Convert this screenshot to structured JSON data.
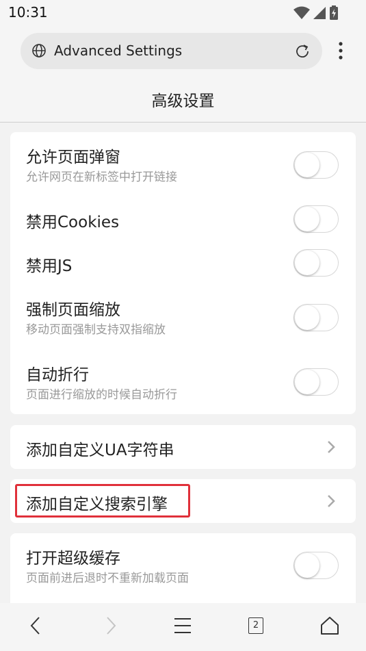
{
  "status": {
    "time": "10:31"
  },
  "urlbar": {
    "text": "Advanced Settings"
  },
  "page": {
    "title": "高级设置"
  },
  "group1": [
    {
      "title": "允许页面弹窗",
      "subtitle": "允许网页在新标签中打开链接",
      "enabled": false
    },
    {
      "title": "禁用Cookies",
      "subtitle": "",
      "enabled": false
    },
    {
      "title": "禁用JS",
      "subtitle": "",
      "enabled": false
    },
    {
      "title": "强制页面缩放",
      "subtitle": "移动页面强制支持双指缩放",
      "enabled": false
    },
    {
      "title": "自动折行",
      "subtitle": "页面进行缩放的时候自动折行",
      "enabled": false
    }
  ],
  "custom_ua": {
    "title": "添加自定义UA字符串"
  },
  "custom_search": {
    "title": "添加自定义搜索引擎"
  },
  "group4": [
    {
      "title": "打开超级缓存",
      "subtitle": "页面前进后退时不重新加载页面",
      "enabled": false
    }
  ],
  "bottom_nav": {
    "tab_count": "2"
  },
  "colors": {
    "highlight": "#e0303a",
    "card": "#ffffff",
    "background": "#f2f2f2"
  }
}
